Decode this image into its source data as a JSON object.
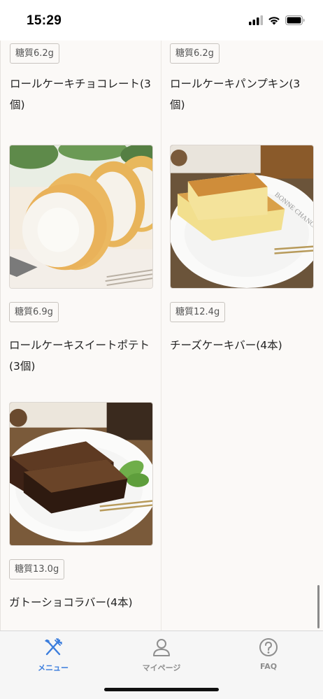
{
  "status_bar": {
    "time": "15:29"
  },
  "products": [
    {
      "carb": "糖質6.2g",
      "name": "ロールケーキチョコレート(3個)",
      "image": "chocolate-roll-cake"
    },
    {
      "carb": "糖質6.2g",
      "name": "ロールケーキパンプキン(3個)",
      "image": "pumpkin-roll-cake"
    },
    {
      "carb": "糖質6.9g",
      "name": "ロールケーキスイートポテト(3個)",
      "image": "sweet-potato-roll-cake"
    },
    {
      "carb": "糖質12.4g",
      "name": "チーズケーキバー(4本)",
      "image": "cheesecake-bar"
    },
    {
      "carb": "糖質13.0g",
      "name": "ガトーショコラバー(4本)",
      "image": "gateau-chocolat-bar"
    }
  ],
  "plate_text": "BONNE CHANCE",
  "tab_bar": {
    "items": [
      {
        "label": "メニュー",
        "icon": "fork-knife-icon",
        "active": true
      },
      {
        "label": "マイページ",
        "icon": "person-icon",
        "active": false
      },
      {
        "label": "FAQ",
        "icon": "question-circle-icon",
        "active": false
      }
    ]
  },
  "colors": {
    "active": "#3b7ddd",
    "inactive": "#8e8e8e"
  }
}
